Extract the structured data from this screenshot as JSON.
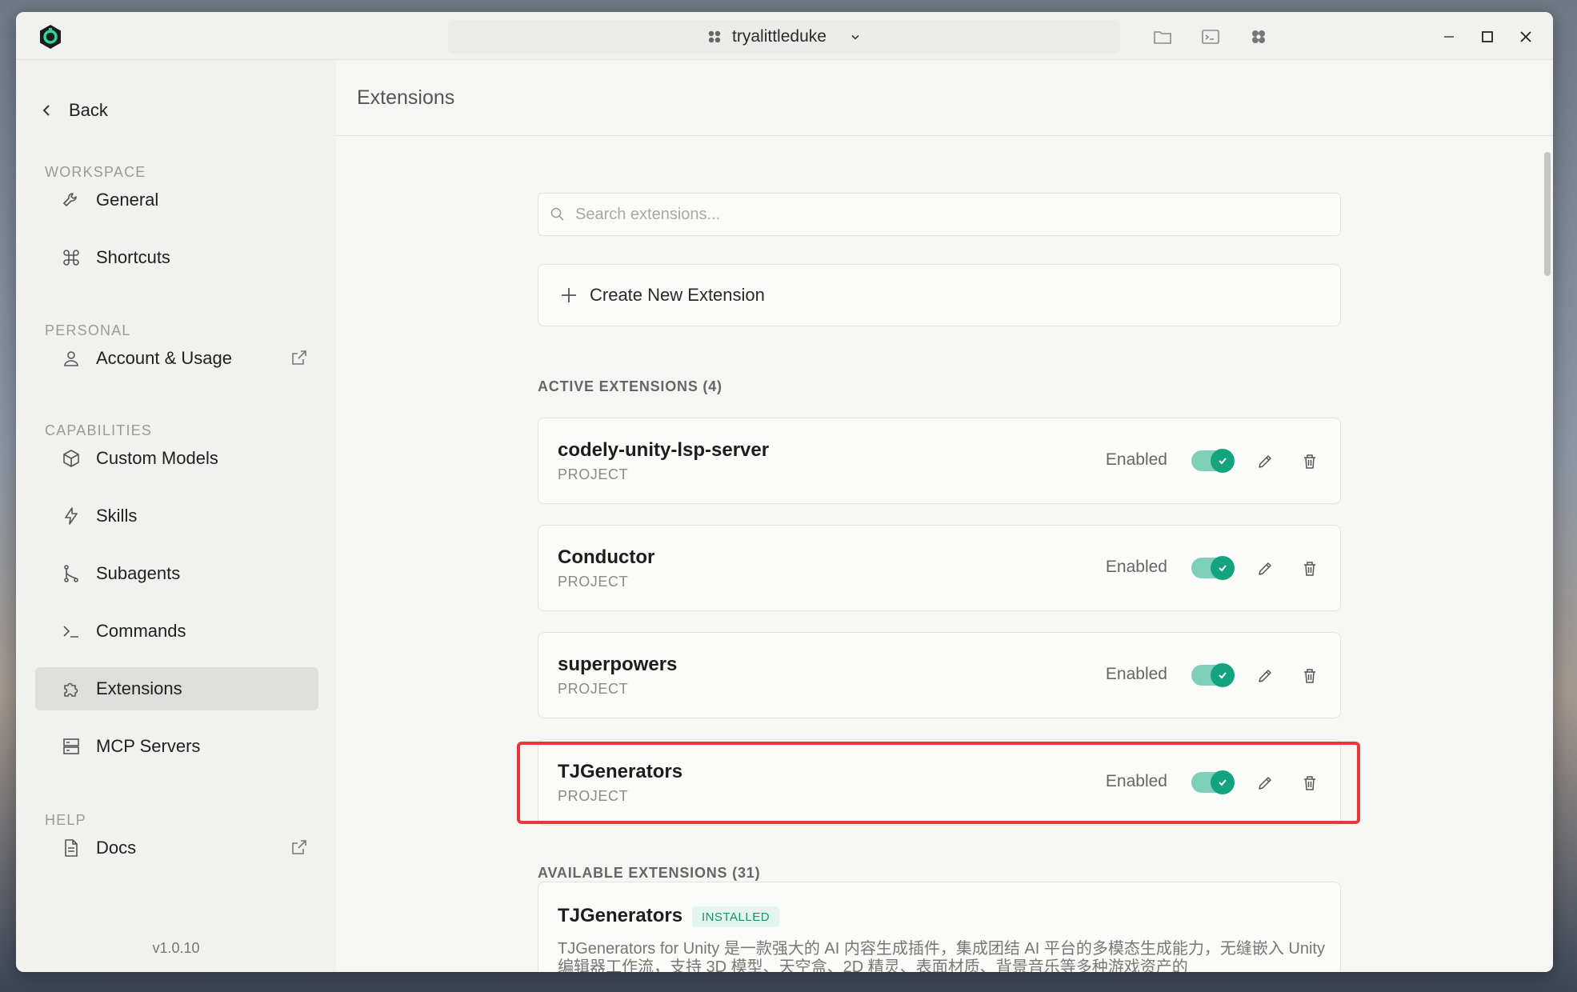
{
  "titlebar": {
    "workspace_name": "tryalittleduke"
  },
  "sidebar": {
    "back_label": "Back",
    "sections": {
      "workspace": "WORKSPACE",
      "personal": "PERSONAL",
      "capabilities": "CAPABILITIES",
      "help": "HELP"
    },
    "items": {
      "general": "General",
      "shortcuts": "Shortcuts",
      "account": "Account & Usage",
      "custom_models": "Custom Models",
      "skills": "Skills",
      "subagents": "Subagents",
      "commands": "Commands",
      "extensions": "Extensions",
      "mcp_servers": "MCP Servers",
      "docs": "Docs"
    },
    "version": "v1.0.10"
  },
  "main": {
    "title": "Extensions",
    "search_placeholder": "Search extensions...",
    "create_label": "Create New Extension",
    "active_label": "ACTIVE EXTENSIONS (4)",
    "active_extensions": [
      {
        "name": "codely-unity-lsp-server",
        "scope": "PROJECT",
        "status": "Enabled",
        "enabled": true
      },
      {
        "name": "Conductor",
        "scope": "PROJECT",
        "status": "Enabled",
        "enabled": true
      },
      {
        "name": "superpowers",
        "scope": "PROJECT",
        "status": "Enabled",
        "enabled": true
      },
      {
        "name": "TJGenerators",
        "scope": "PROJECT",
        "status": "Enabled",
        "enabled": true
      }
    ],
    "available_label": "AVAILABLE EXTENSIONS (31)",
    "available_extensions": [
      {
        "name": "TJGenerators",
        "badge": "INSTALLED",
        "description": "TJGenerators for Unity 是一款强大的 AI 内容生成插件，集成团结 AI 平台的多模态生成能力，无缝嵌入 Unity 编辑器工作流，支持 3D 模型、天空盒、2D 精灵、表面材质、背景音乐等多种游戏资产的"
      }
    ]
  },
  "colors": {
    "accent_green": "#14a37f",
    "highlight_red": "#e5393b",
    "active_nav_bg": "#dededd"
  }
}
